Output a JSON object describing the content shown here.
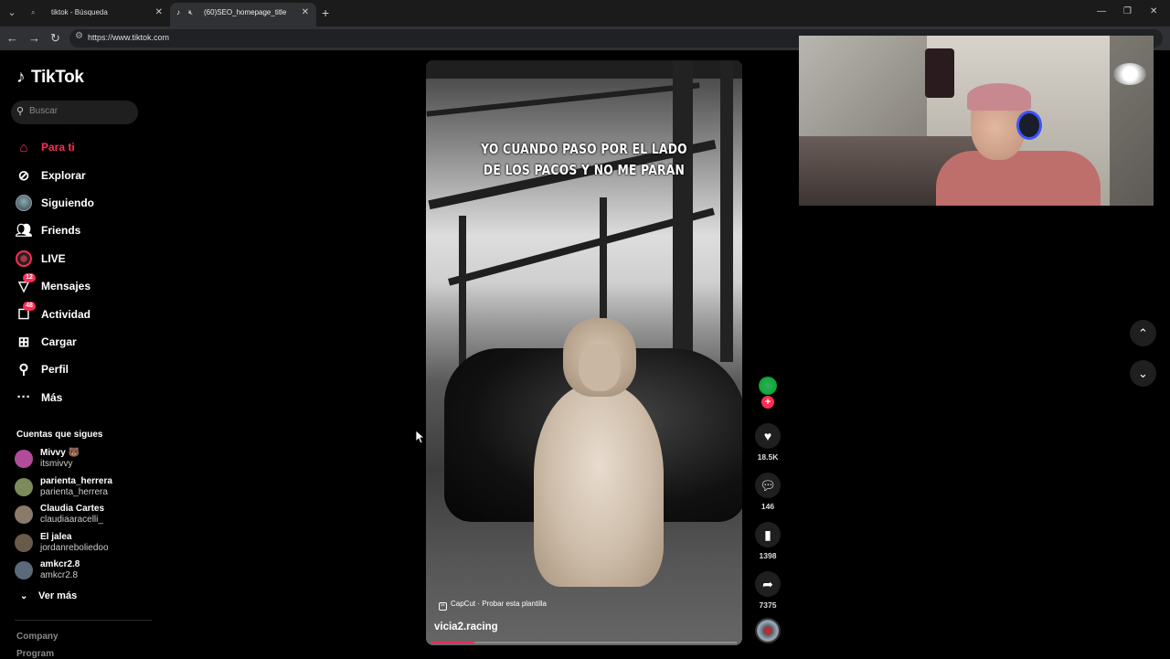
{
  "browser": {
    "tabs": [
      {
        "title": "tiktok - Búsqueda"
      },
      {
        "title": "(60)SEO_homepage_title"
      }
    ],
    "url": "https://www.tiktok.com"
  },
  "sidebar": {
    "logo": "TikTok",
    "search_placeholder": "Buscar",
    "nav": [
      {
        "label": "Para ti"
      },
      {
        "label": "Explorar"
      },
      {
        "label": "Siguiendo"
      },
      {
        "label": "Friends"
      },
      {
        "label": "LIVE"
      },
      {
        "label": "Mensajes",
        "badge": "12"
      },
      {
        "label": "Actividad",
        "badge": "48"
      },
      {
        "label": "Cargar"
      },
      {
        "label": "Perfil"
      },
      {
        "label": "Más"
      }
    ],
    "following_title": "Cuentas que sigues",
    "following": [
      {
        "name": "Mivvy 🐻",
        "handle": "itsmivvy",
        "color": "#b24c9a"
      },
      {
        "name": "parienta_herrera",
        "handle": "parienta_herrera",
        "color": "#7b8b5a"
      },
      {
        "name": "Claudia Cartes",
        "handle": "claudiaaracelli_",
        "color": "#8a7a6a"
      },
      {
        "name": "El jalea",
        "handle": "jordanreboliedoo",
        "color": "#6a5a4a"
      },
      {
        "name": "amkcr2.8",
        "handle": "amkcr2.8",
        "color": "#5a6a7a"
      }
    ],
    "see_more": "Ver más",
    "footer": [
      "Company",
      "Program"
    ]
  },
  "video": {
    "caption": "YO CUANDO PASO POR EL LADO DE LOS PACOS Y NO ME PARAN",
    "template_label": "CapCut · Probar esta plantilla",
    "author": "vicia2.racing",
    "progress": 0.14,
    "likes": "18.5K",
    "comments": "146",
    "saves": "1398",
    "shares": "7375"
  }
}
